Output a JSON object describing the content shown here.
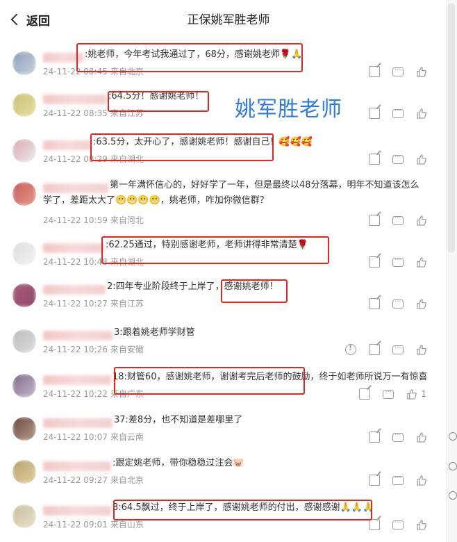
{
  "header": {
    "back_label": "返回",
    "title": "正保姚军胜老师"
  },
  "overlay_title": "姚军胜老师",
  "comments": [
    {
      "text": ":姚老师，今年考试我通过了，68分，感谢姚老师🌹🙏",
      "date": "24-11-22 08:45",
      "location": "来自北京"
    },
    {
      "text": ":64.5分！感谢姚老师！",
      "date": "24-11-22 08:35",
      "location": "来自江苏"
    },
    {
      "text": ":63.5分，太开心了，感谢姚老师！感谢自己！🥰🥰🥰",
      "date": "24-11-22 08:29",
      "location": "来自湖北"
    },
    {
      "text": "第一年满怀信心的，好好学了一年，但是最终以48分落幕，明年不知道该怎么学了，差距太大了😬😬😬😬，姚老师，咋加你微信群？",
      "date": "24-11-22 10:59",
      "location": "来自河北"
    },
    {
      "text": ":62.25通过，特别感谢老师，老师讲得非常清楚🌹",
      "date": "24-11-22 10:48",
      "location": "来自湖北"
    },
    {
      "text": "2:四年专业阶段终于上岸了，感谢姚老师！",
      "date": "24-11-22 10:27",
      "location": "来自江苏"
    },
    {
      "text": "3:跟着姚老师学财管",
      "date": "24-11-22 10:26",
      "location": "来自安徽"
    },
    {
      "text": "18:财管60，感谢姚老师，谢谢考完后老师的鼓励，终于如老师所说万一有惊喜",
      "date": "24-11-22 10:22",
      "location": "来自广东",
      "likes": "1"
    },
    {
      "text": "37:差8分，也不知道是差哪里了",
      "date": "24-11-22 10:07",
      "location": "来自云南"
    },
    {
      "text": ":跟定姚老师，带你稳稳过注会🐷",
      "date": "24-11-22 09:27",
      "location": "来自北京"
    },
    {
      "text": "8:64.5飘过，终于上岸了，感谢姚老师的付出，感谢感谢🙏🙏🙏",
      "date": "24-11-22 09:01",
      "location": "来自山东"
    }
  ],
  "icons": [
    "share-icon",
    "comment-icon",
    "like-icon",
    "report-icon"
  ],
  "colors": {
    "highlight": "#e0261e",
    "overlay_text": "#2c7be5",
    "meta": "#999999"
  }
}
